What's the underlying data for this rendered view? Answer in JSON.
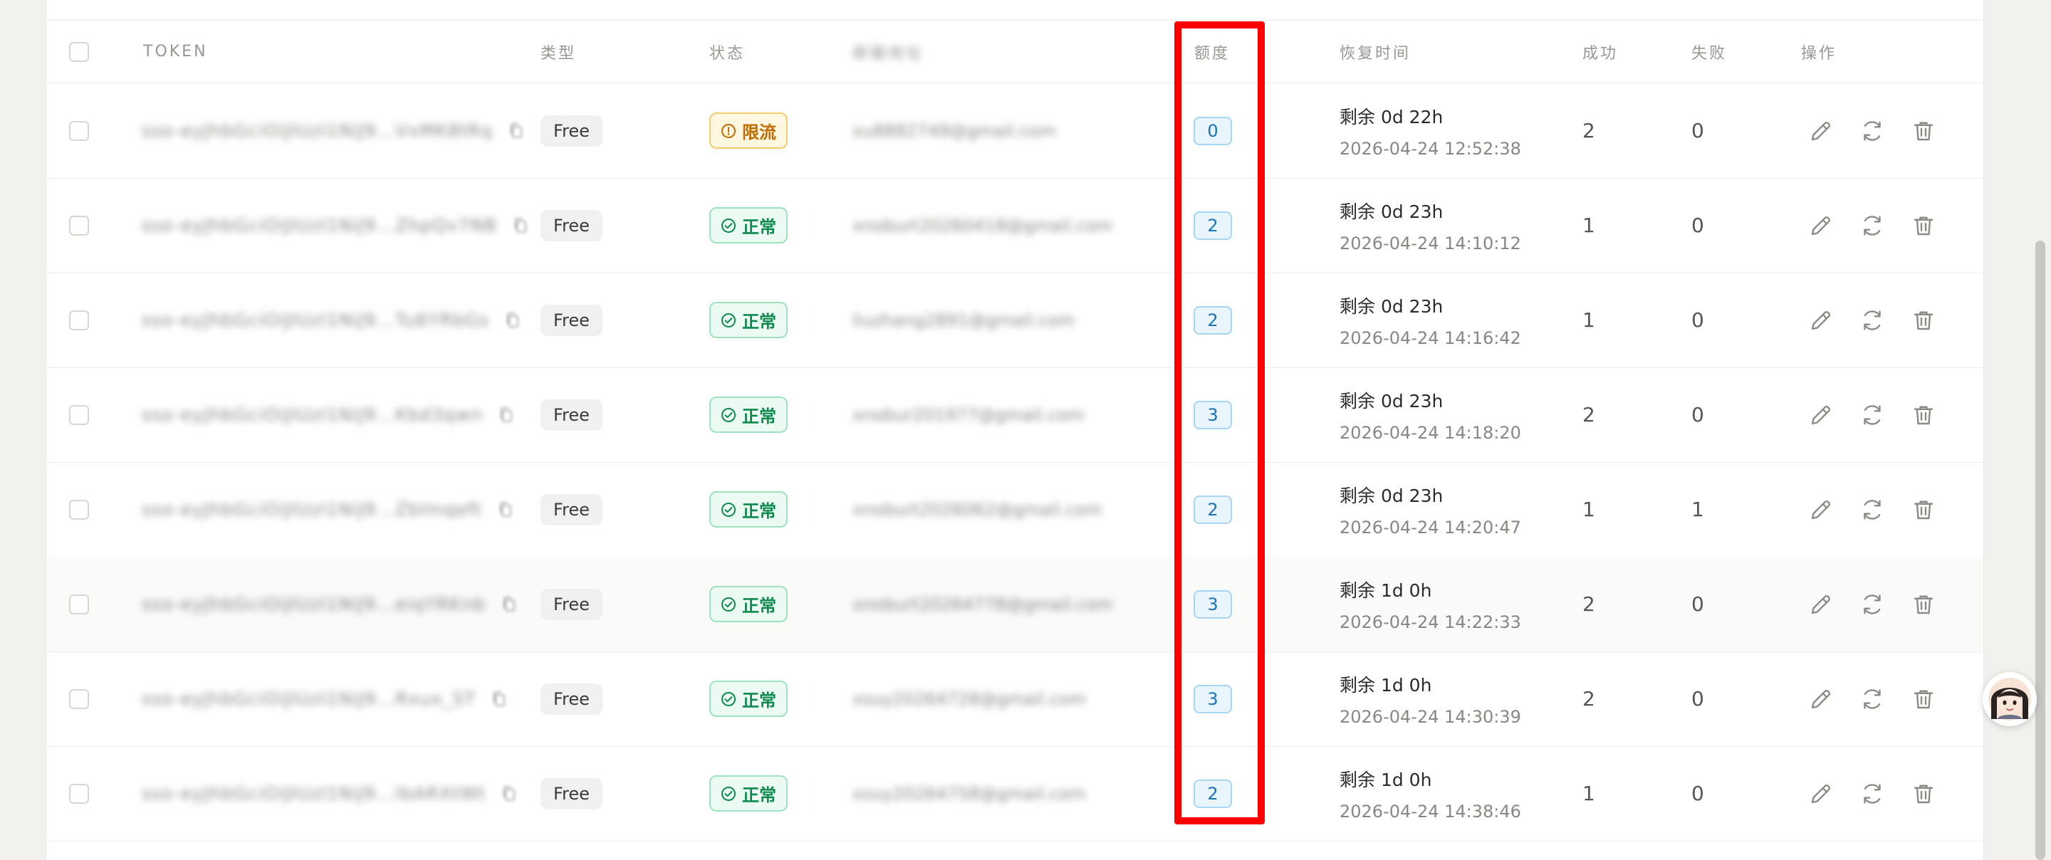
{
  "table": {
    "columns": {
      "token": "TOKEN",
      "type": "类型",
      "status": "状态",
      "email": "邮箱地址",
      "quota": "额度",
      "recover": "恢复时间",
      "success": "成功",
      "fail": "失败",
      "actions": "操作"
    },
    "rows": [
      {
        "token": "sso-eyJhbGciOiJIUzI1NiJ9...VxMK8tRq",
        "type": "Free",
        "status": "限流",
        "status_kind": "warn",
        "email": "xu8882749@gmail.com",
        "quota": "0",
        "remaining": "剩余 0d 22h",
        "recover_time": "2026-04-24 12:52:38",
        "success": "2",
        "fail": "0"
      },
      {
        "token": "sso-eyJhbGciOiJIUzI1NiJ9...ZhpQv7NB",
        "type": "Free",
        "status": "正常",
        "status_kind": "ok",
        "email": "xnoburt20260418@gmail.com",
        "quota": "2",
        "remaining": "剩余 0d 23h",
        "recover_time": "2026-04-24 14:10:12",
        "success": "1",
        "fail": "0"
      },
      {
        "token": "sso-eyJhbGciOiJIUzI1NiJ9...Tu6YRbGs",
        "type": "Free",
        "status": "正常",
        "status_kind": "ok",
        "email": "liuzhang2891@gmail.com",
        "quota": "2",
        "remaining": "剩余 0d 23h",
        "recover_time": "2026-04-24 14:16:42",
        "success": "1",
        "fail": "0"
      },
      {
        "token": "sso-eyJhbGciOiJIUzI1NiJ9...Kbd3qwn",
        "type": "Free",
        "status": "正常",
        "status_kind": "ok",
        "email": "xnobur201977@gmail.com",
        "quota": "3",
        "remaining": "剩余 0d 23h",
        "recover_time": "2026-04-24 14:18:20",
        "success": "2",
        "fail": "0"
      },
      {
        "token": "sso-eyJhbGciOiJIUzI1NiJ9...Zblmqeft",
        "type": "Free",
        "status": "正常",
        "status_kind": "ok",
        "email": "xnoburt2026062@gmail.com",
        "quota": "2",
        "remaining": "剩余 0d 23h",
        "recover_time": "2026-04-24 14:20:47",
        "success": "1",
        "fail": "1"
      },
      {
        "token": "sso-eyJhbGciOiJIUzI1NiJ9...eiqYRKnb",
        "type": "Free",
        "status": "正常",
        "status_kind": "ok",
        "email": "xnoburt20264778@gmail.com",
        "quota": "3",
        "remaining": "剩余 1d 0h",
        "recover_time": "2026-04-24 14:22:33",
        "success": "2",
        "fail": "0"
      },
      {
        "token": "sso-eyJhbGciOiJIUzI1NiJ9...Rxux_ST",
        "type": "Free",
        "status": "正常",
        "status_kind": "ok",
        "email": "xsuy20264728@gmail.com",
        "quota": "3",
        "remaining": "剩余 1d 0h",
        "recover_time": "2026-04-24 14:30:39",
        "success": "2",
        "fail": "0"
      },
      {
        "token": "sso-eyJhbGciOiJIUzI1NiJ9...IbARXtWt",
        "type": "Free",
        "status": "正常",
        "status_kind": "ok",
        "email": "xsuy20264758@gmail.com",
        "quota": "2",
        "remaining": "剩余 1d 0h",
        "recover_time": "2026-04-24 14:38:46",
        "success": "1",
        "fail": "0"
      }
    ]
  },
  "icons": {
    "edit": "pencil-icon",
    "refresh": "refresh-icon",
    "delete": "trash-icon",
    "copy": "copy-icon",
    "status_ok": "check-circle-icon",
    "status_warn": "alert-circle-icon"
  },
  "colors": {
    "highlight": "#ff0000",
    "status_ok": "#0e8a4f",
    "status_warn": "#c06a00",
    "quota": "#1a73b8"
  }
}
